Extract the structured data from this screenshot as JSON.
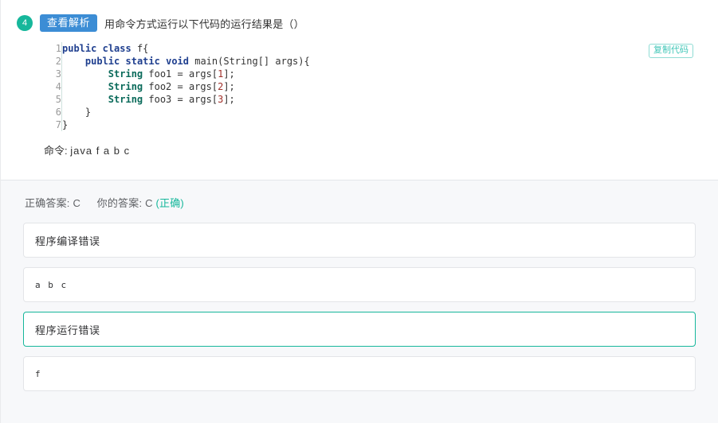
{
  "question": {
    "number": "4",
    "analysis_button_label": "查看解析",
    "text": "用命令方式运行以下代码的运行结果是（）",
    "copy_code_label": "复制代码",
    "code_lines": [
      {
        "n": "1",
        "tokens": [
          {
            "t": "public",
            "c": "kw"
          },
          {
            "t": " ",
            "c": "pln"
          },
          {
            "t": "class",
            "c": "kw"
          },
          {
            "t": " f{",
            "c": "pln"
          }
        ]
      },
      {
        "n": "2",
        "tokens": [
          {
            "t": "    ",
            "c": "pln"
          },
          {
            "t": "public",
            "c": "kw"
          },
          {
            "t": " ",
            "c": "pln"
          },
          {
            "t": "static",
            "c": "kw"
          },
          {
            "t": " ",
            "c": "pln"
          },
          {
            "t": "void",
            "c": "kw"
          },
          {
            "t": " main(String[] args){",
            "c": "pln"
          }
        ]
      },
      {
        "n": "3",
        "tokens": [
          {
            "t": "        ",
            "c": "pln"
          },
          {
            "t": "String",
            "c": "typ"
          },
          {
            "t": " foo1 = args[",
            "c": "pln"
          },
          {
            "t": "1",
            "c": "num"
          },
          {
            "t": "];",
            "c": "pln"
          }
        ]
      },
      {
        "n": "4",
        "tokens": [
          {
            "t": "        ",
            "c": "pln"
          },
          {
            "t": "String",
            "c": "typ"
          },
          {
            "t": " foo2 = args[",
            "c": "pln"
          },
          {
            "t": "2",
            "c": "num"
          },
          {
            "t": "];",
            "c": "pln"
          }
        ]
      },
      {
        "n": "5",
        "tokens": [
          {
            "t": "        ",
            "c": "pln"
          },
          {
            "t": "String",
            "c": "typ"
          },
          {
            "t": " foo3 = args[",
            "c": "pln"
          },
          {
            "t": "3",
            "c": "num"
          },
          {
            "t": "];",
            "c": "pln"
          }
        ]
      },
      {
        "n": "6",
        "tokens": [
          {
            "t": "    }",
            "c": "pln"
          }
        ]
      },
      {
        "n": "7",
        "tokens": [
          {
            "t": "}",
            "c": "pln"
          }
        ]
      }
    ],
    "command_label": "命令:",
    "command_value": "java f a b c"
  },
  "answer": {
    "correct_label": "正确答案:",
    "correct_value": "C",
    "your_label": "你的答案:",
    "your_value": "C",
    "result_flag": "(正确)",
    "options": [
      {
        "text": "程序编译错误",
        "mono": false,
        "selected": false
      },
      {
        "text": "a b c",
        "mono": true,
        "selected": false
      },
      {
        "text": "程序运行错误",
        "mono": false,
        "selected": true
      },
      {
        "text": "f",
        "mono": true,
        "selected": false
      }
    ]
  },
  "colors": {
    "accent_teal": "#16b79b",
    "button_blue": "#3c8dd5",
    "copy_border": "#8fdcd4",
    "page_bg": "#f7f8fa"
  }
}
